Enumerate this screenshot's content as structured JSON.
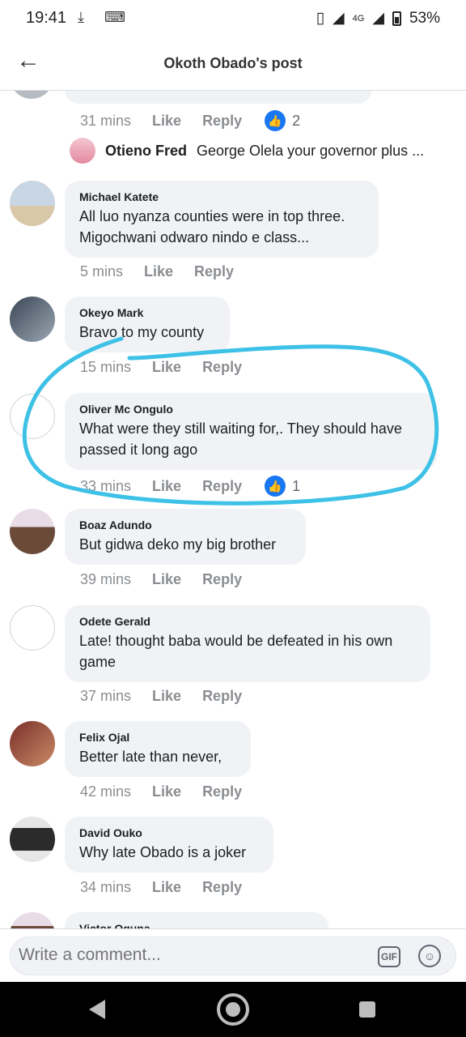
{
  "status": {
    "time": "19:41",
    "network": "4G",
    "battery": "53%"
  },
  "header": {
    "title": "Okoth Obado's post"
  },
  "top_meta": {
    "time": "31 mins",
    "like": "Like",
    "reply": "Reply",
    "reaction_count": "2"
  },
  "reply_preview": {
    "name": "Otieno Fred",
    "text": "George Olela your governor plus ..."
  },
  "comments": [
    {
      "name": "Michael Katete",
      "text": "All luo nyanza counties were in top three. Migochwani odwaro nindo e class...",
      "time": "5 mins",
      "like": "Like",
      "reply": "Reply"
    },
    {
      "name": "Okeyo Mark",
      "text": "Bravo to my county",
      "time": "15 mins",
      "like": "Like",
      "reply": "Reply"
    },
    {
      "name": "Oliver Mc Ongulo",
      "text": "What were they still waiting for,. They should have passed it long ago",
      "time": "33 mins",
      "like": "Like",
      "reply": "Reply",
      "reaction_count": "1"
    },
    {
      "name": "Boaz Adundo",
      "text": "But gidwa deko my big brother",
      "time": "39 mins",
      "like": "Like",
      "reply": "Reply"
    },
    {
      "name": "Odete Gerald",
      "text": "Late! thought baba would be defeated in his own game",
      "time": "37 mins",
      "like": "Like",
      "reply": "Reply"
    },
    {
      "name": "Felix Ojal",
      "text": "Better late than never,",
      "time": "42 mins",
      "like": "Like",
      "reply": "Reply"
    },
    {
      "name": "David Ouko",
      "text": "Why late Obado is a joker",
      "time": "34 mins",
      "like": "Like",
      "reply": "Reply"
    },
    {
      "name": "Victor Oguna"
    }
  ],
  "composer": {
    "placeholder": "Write a comment...",
    "gif_label": "GIF"
  },
  "colors": {
    "accent": "#1877f2",
    "bubble": "#f0f2f5",
    "annotation": "#3ec1e6"
  }
}
